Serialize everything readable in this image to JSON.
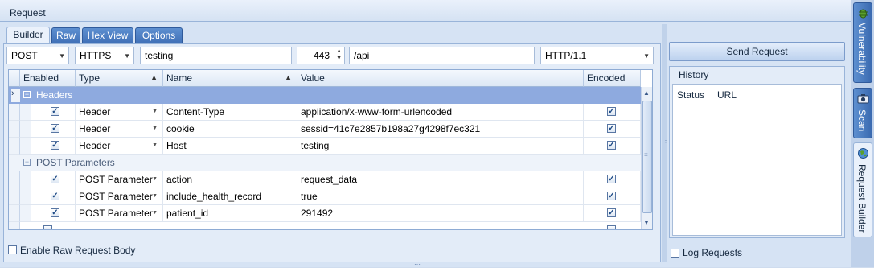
{
  "panel": {
    "title": "Request"
  },
  "tabs": [
    {
      "label": "Builder",
      "active": true
    },
    {
      "label": "Raw"
    },
    {
      "label": "Hex View"
    },
    {
      "label": "Options"
    }
  ],
  "request_line": {
    "method": "POST",
    "protocol": "HTTPS",
    "host": "testing",
    "port": "443",
    "path": "/api",
    "version": "HTTP/1.1"
  },
  "grid": {
    "columns": [
      "Enabled",
      "Type",
      "Name",
      "Value",
      "Encoded"
    ],
    "groups": [
      {
        "label": "Headers",
        "rows": [
          {
            "enabled": true,
            "type": "Header",
            "name": "Content-Type",
            "value": "application/x-www-form-urlencoded",
            "encoded": true
          },
          {
            "enabled": true,
            "type": "Header",
            "name": "cookie",
            "value": "sessid=41c7e2857b198a27g4298f7ec321",
            "encoded": true
          },
          {
            "enabled": true,
            "type": "Header",
            "name": "Host",
            "value": "testing",
            "encoded": true
          }
        ]
      },
      {
        "label": "POST Parameters",
        "rows": [
          {
            "enabled": true,
            "type": "POST Parameter",
            "name": "action",
            "value": "request_data",
            "encoded": true
          },
          {
            "enabled": true,
            "type": "POST Parameter",
            "name": "include_health_record",
            "value": "true",
            "encoded": true
          },
          {
            "enabled": true,
            "type": "POST Parameter",
            "name": "patient_id",
            "value": "291492",
            "encoded": true
          }
        ]
      }
    ]
  },
  "raw_body_label": "Enable Raw Request Body",
  "send_button": "Send Request",
  "history": {
    "title": "History",
    "columns": [
      "Status",
      "URL"
    ]
  },
  "log_requests_label": "Log Requests",
  "side_tabs": [
    {
      "label": "Vulnerability",
      "icon": "bug-icon"
    },
    {
      "label": "Scan",
      "icon": "camera-icon"
    },
    {
      "label": "Request Builder",
      "icon": "globe-icon",
      "active": true
    }
  ],
  "colors": {
    "accent": "#3f6fb6",
    "group_header": "#8eaadf",
    "panel_bg": "#d6e3f4"
  }
}
